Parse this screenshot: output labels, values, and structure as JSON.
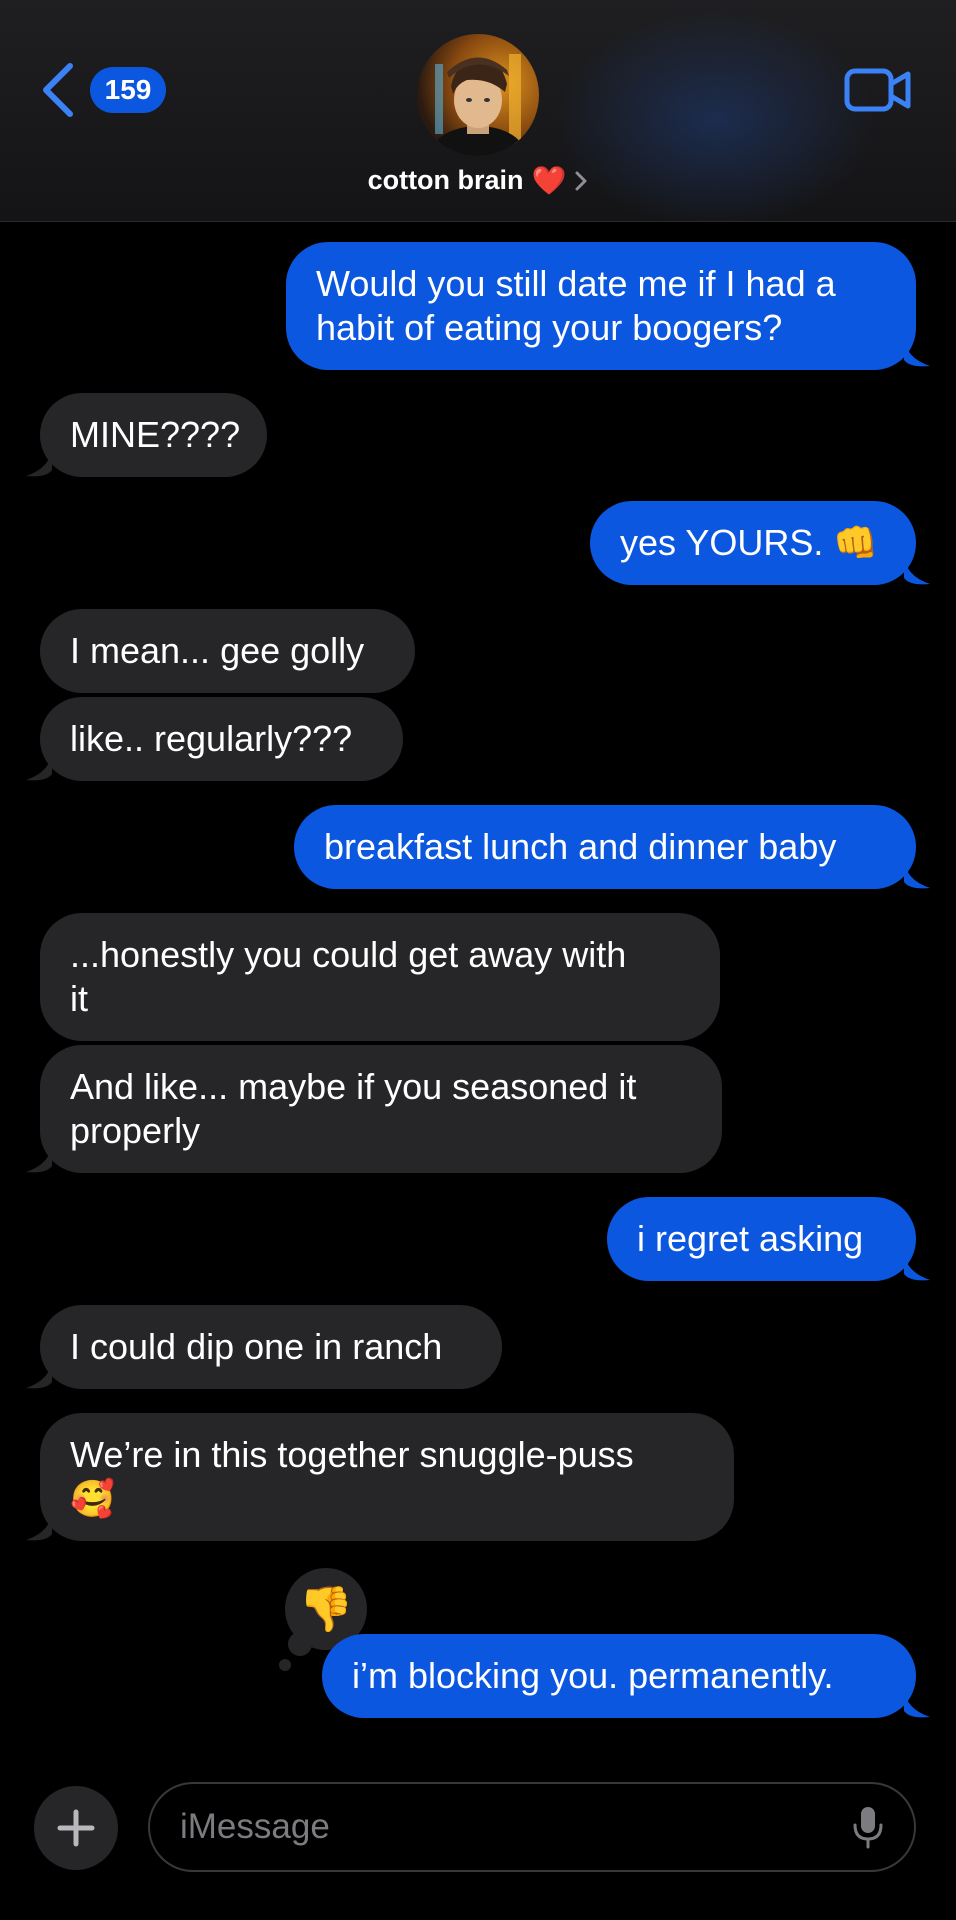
{
  "header": {
    "unread_count": "159",
    "contact_name": "cotton brain",
    "contact_emoji": "❤️",
    "back_icon": "chevron-left-icon",
    "video_icon": "video-camera-icon"
  },
  "messages": [
    {
      "from": "me",
      "text": "Would you still date me if I had a\nhabit of eating your boogers?"
    },
    {
      "from": "them",
      "text": "MINE????"
    },
    {
      "from": "me",
      "text": "yes YOURS. 👊"
    },
    {
      "from": "them",
      "text": "I mean... gee golly"
    },
    {
      "from": "them",
      "text": "like.. regularly???"
    },
    {
      "from": "me",
      "text": "breakfast lunch and dinner baby"
    },
    {
      "from": "them",
      "text": "...honestly you could get away with\nit"
    },
    {
      "from": "them",
      "text": "And like... maybe if you seasoned it\nproperly"
    },
    {
      "from": "me",
      "text": "i regret asking"
    },
    {
      "from": "them",
      "text": "I could dip one in ranch"
    },
    {
      "from": "them",
      "text": "We’re in this together snuggle-puss\n🥰"
    },
    {
      "from": "me",
      "text": "i’m blocking you. permanently."
    }
  ],
  "reaction": {
    "emoji": "👎",
    "icon": "thumbs-down-icon"
  },
  "composer": {
    "placeholder": "iMessage",
    "plus_icon": "plus-icon",
    "mic_icon": "microphone-icon"
  },
  "colors": {
    "sent_bubble": "#0b57e0",
    "received_bubble": "#262628",
    "background": "#000000",
    "accent": "#3b82f6"
  }
}
